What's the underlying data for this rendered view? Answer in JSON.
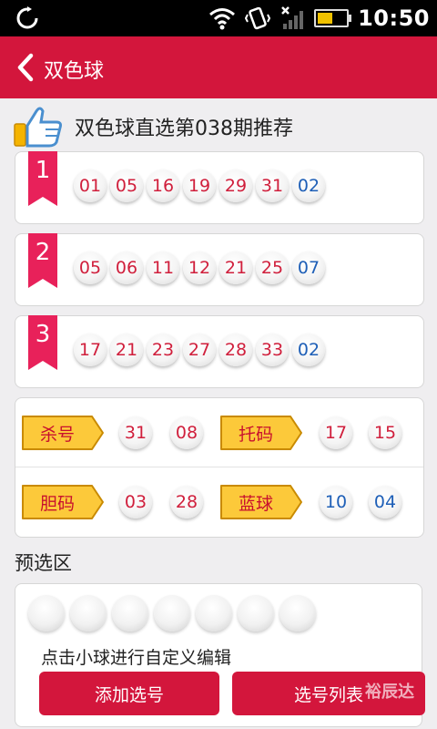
{
  "status_bar": {
    "time": "10:50"
  },
  "header": {
    "title": "双色球"
  },
  "recommend": {
    "title": "双色球直选第038期推荐"
  },
  "groups": [
    {
      "index": "1",
      "balls": [
        {
          "n": "01",
          "c": "red"
        },
        {
          "n": "05",
          "c": "red"
        },
        {
          "n": "16",
          "c": "red"
        },
        {
          "n": "19",
          "c": "red"
        },
        {
          "n": "29",
          "c": "red"
        },
        {
          "n": "31",
          "c": "red"
        },
        {
          "n": "02",
          "c": "blue"
        }
      ]
    },
    {
      "index": "2",
      "balls": [
        {
          "n": "05",
          "c": "red"
        },
        {
          "n": "06",
          "c": "red"
        },
        {
          "n": "11",
          "c": "red"
        },
        {
          "n": "12",
          "c": "red"
        },
        {
          "n": "21",
          "c": "red"
        },
        {
          "n": "25",
          "c": "red"
        },
        {
          "n": "07",
          "c": "blue"
        }
      ]
    },
    {
      "index": "3",
      "balls": [
        {
          "n": "17",
          "c": "red"
        },
        {
          "n": "21",
          "c": "red"
        },
        {
          "n": "23",
          "c": "red"
        },
        {
          "n": "27",
          "c": "red"
        },
        {
          "n": "28",
          "c": "red"
        },
        {
          "n": "33",
          "c": "red"
        },
        {
          "n": "02",
          "c": "blue"
        }
      ]
    }
  ],
  "tags": {
    "kill": {
      "label": "杀号",
      "balls": [
        "31",
        "08"
      ]
    },
    "tuo": {
      "label": "托码",
      "balls": [
        "17",
        "15"
      ]
    },
    "dan": {
      "label": "胆码",
      "balls": [
        "03",
        "28"
      ]
    },
    "blue": {
      "label": "蓝球",
      "balls": [
        "10",
        "04"
      ]
    }
  },
  "preselect": {
    "label": "预选区",
    "hint": "点击小球进行自定义编辑",
    "add_button": "添加选号",
    "list_button": "选号列表",
    "watermark": "裕辰达"
  },
  "colors": {
    "accent": "#d3163c",
    "red_ball": "#d01f3c",
    "blue_ball": "#1e5fb7",
    "tag_fill": "#fcc93a"
  }
}
